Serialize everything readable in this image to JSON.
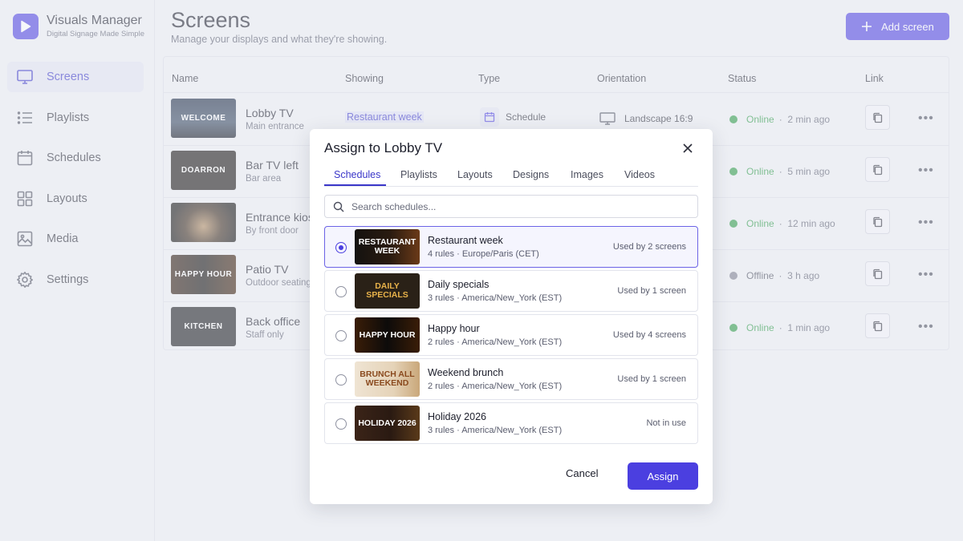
{
  "app": {
    "name": "Visuals Manager",
    "tagline": "Digital Signage Made Simple"
  },
  "nav": [
    {
      "label": "Screens",
      "icon": "monitor-icon",
      "active": true
    },
    {
      "label": "Playlists",
      "icon": "list-icon"
    },
    {
      "label": "Schedules",
      "icon": "calendar-icon"
    },
    {
      "label": "Layouts",
      "icon": "grid-icon"
    },
    {
      "label": "Media",
      "icon": "image-icon"
    },
    {
      "label": "Settings",
      "icon": "gear-icon"
    }
  ],
  "header": {
    "title": "Screens",
    "subtitle": "Manage your displays and what they're showing.",
    "add_label": "Add screen"
  },
  "table": {
    "columns": [
      "Name",
      "Showing",
      "Type",
      "Orientation",
      "Status",
      "Link"
    ],
    "rows": [
      {
        "name": "Lobby TV",
        "location": "Main entrance",
        "thumb": "WELCOME",
        "showing": "Restaurant week",
        "type": "Schedule",
        "orientation": "Landscape 16:9",
        "status": "Online",
        "ago": "2 min ago"
      },
      {
        "name": "Bar TV left",
        "location": "Bar area",
        "thumb": "DOARRON",
        "status": "Online",
        "ago": "5 min ago"
      },
      {
        "name": "Entrance kiosk",
        "location": "By front door",
        "thumb": "",
        "status": "Online",
        "ago": "12 min ago"
      },
      {
        "name": "Patio TV",
        "location": "Outdoor seating",
        "thumb": "HAPPY HOUR",
        "status": "Offline",
        "ago": "3 h ago"
      },
      {
        "name": "Back office",
        "location": "Staff only",
        "thumb": "KITCHEN",
        "status": "Online",
        "ago": "1 min ago"
      }
    ]
  },
  "modal": {
    "title": "Assign to Lobby TV",
    "tabs": [
      "Schedules",
      "Playlists",
      "Layouts",
      "Designs",
      "Images",
      "Videos"
    ],
    "active_tab": "Schedules",
    "search_placeholder": "Search schedules...",
    "options": [
      {
        "name": "Restaurant week",
        "rules": "4 rules",
        "tz": "Europe/Paris (CET)",
        "usage": "Used by 2 screens",
        "thumb": "RESTAURANT WEEK",
        "selected": true
      },
      {
        "name": "Daily specials",
        "rules": "3 rules",
        "tz": "America/New_York (EST)",
        "usage": "Used by 1 screen",
        "thumb": "DAILY SPECIALS"
      },
      {
        "name": "Happy hour",
        "rules": "2 rules",
        "tz": "America/New_York (EST)",
        "usage": "Used by 4 screens",
        "thumb": "HAPPY HOUR"
      },
      {
        "name": "Weekend brunch",
        "rules": "2 rules",
        "tz": "America/New_York (EST)",
        "usage": "Used by 1 screen",
        "thumb": "BRUNCH ALL WEEKEND"
      },
      {
        "name": "Holiday 2026",
        "rules": "3 rules",
        "tz": "America/New_York (EST)",
        "usage": "Not in use",
        "thumb": "HOLIDAY 2026"
      }
    ],
    "cancel_label": "Cancel",
    "assign_label": "Assign"
  },
  "colors": {
    "accent": "#4b3fe0",
    "online": "#2b9a44",
    "offline": "#7c7f8e"
  }
}
